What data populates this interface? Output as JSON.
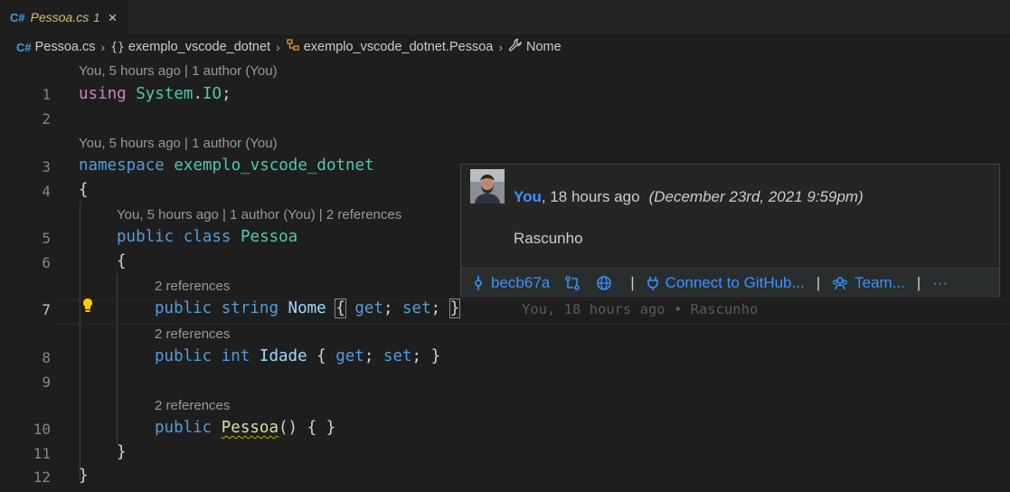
{
  "tab": {
    "lang": "C#",
    "filename": "Pessoa.cs",
    "problems": "1",
    "close": "×"
  },
  "breadcrumb": {
    "lang": "C#",
    "file": "Pessoa.cs",
    "namespace": "exemplo_vscode_dotnet",
    "class": "exemplo_vscode_dotnet.Pessoa",
    "property": "Nome"
  },
  "codelens": {
    "blame_ns": "You, 5 hours ago | 1 author (You)",
    "blame_ns2": "You, 5 hours ago | 1 author (You)",
    "blame_class": "You, 5 hours ago | 1 author (You) | 2 references",
    "refs": "2 references"
  },
  "lines": [
    "1",
    "2",
    "3",
    "4",
    "5",
    "6",
    "7",
    "8",
    "9",
    "10",
    "11",
    "12"
  ],
  "ghost_blame": "You, 18 hours ago • Rascunho",
  "hover": {
    "author": "You",
    "relative": ", 18 hours ago",
    "date": "(December 23rd, 2021 9:59pm)",
    "message": "Rascunho",
    "commit": "becb67a",
    "connect": "Connect to GitHub...",
    "team": "Team...",
    "more": "···"
  }
}
